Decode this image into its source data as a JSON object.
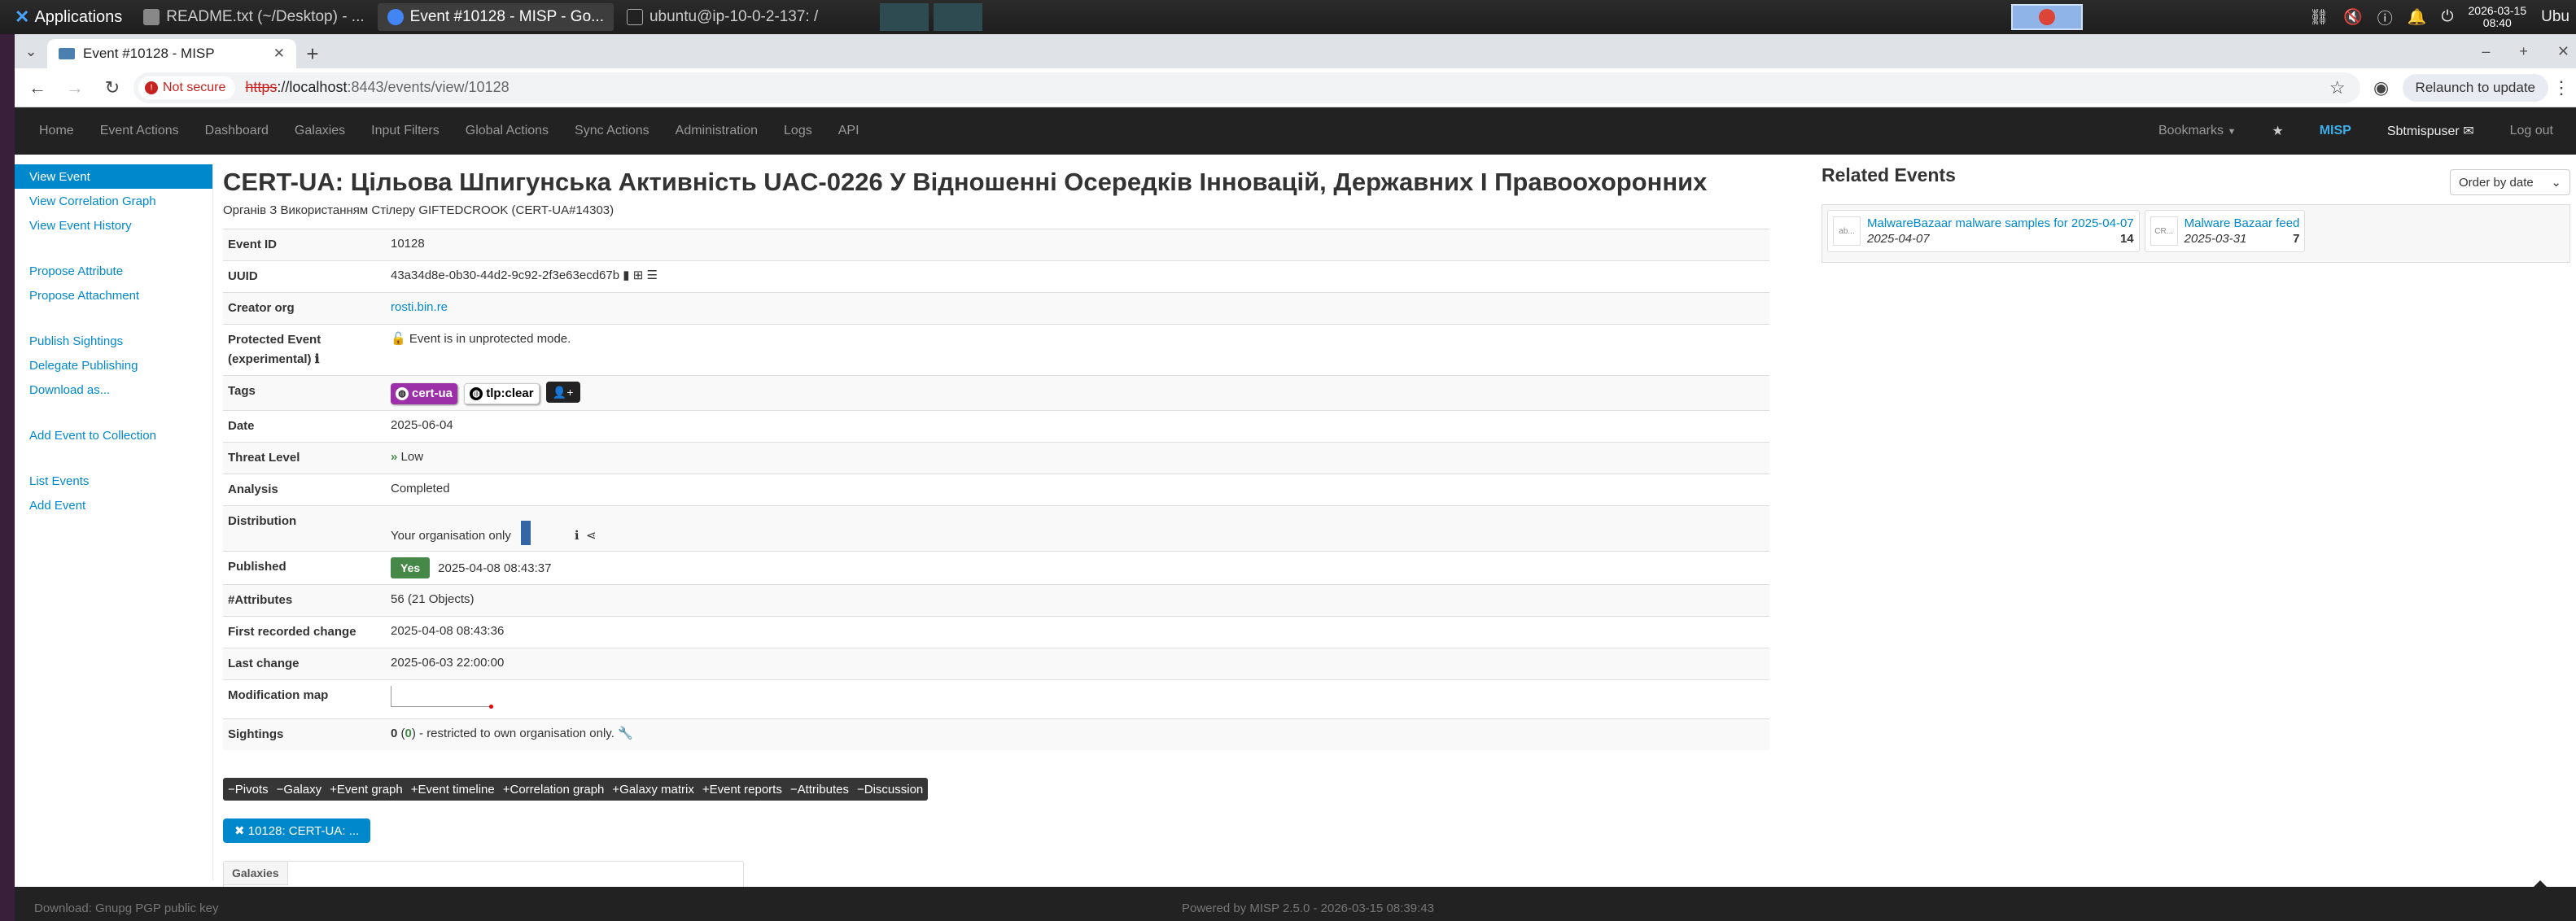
{
  "taskbar": {
    "apps_label": "Applications",
    "tasks": [
      {
        "label": "README.txt (~/Desktop) - ..."
      },
      {
        "label": "Event #10128 - MISP - Go..."
      },
      {
        "label": "ubuntu@ip-10-0-2-137: /"
      }
    ],
    "clock_date": "2026-03-15",
    "clock_time": "08:40",
    "tray_user": "Ubu"
  },
  "browser": {
    "tab_title": "Event #10128 - MISP",
    "not_secure": "Not secure",
    "url_scheme": "https",
    "url_host": "://localhost",
    "url_path": ":8443/events/view/10128",
    "relaunch": "Relaunch to update"
  },
  "mispnav": {
    "items": [
      "Home",
      "Event Actions",
      "Dashboard",
      "Galaxies",
      "Input Filters",
      "Global Actions",
      "Sync Actions",
      "Administration",
      "Logs",
      "API"
    ],
    "bookmarks": "Bookmarks",
    "misp": "MISP",
    "user": "Sbtmispuser",
    "logout": "Log out"
  },
  "sidebar": {
    "view_event": "View Event",
    "view_correlation_graph": "View Correlation Graph",
    "view_event_history": "View Event History",
    "propose_attribute": "Propose Attribute",
    "propose_attachment": "Propose Attachment",
    "publish_sightings": "Publish Sightings",
    "delegate_publishing": "Delegate Publishing",
    "download_as": "Download as...",
    "add_event_to_collection": "Add Event to Collection",
    "list_events": "List Events",
    "add_event": "Add Event"
  },
  "event": {
    "title": "CERT-UA: Цільова Шпигунська Активність UAC-0226 У Відношенні Осередків Інновацій, Державних І Правоохоронних",
    "subtitle": "Органів З Використанням Стілеру GIFTEDCROOK (CERT-UA#14303)",
    "labels": {
      "event_id": "Event ID",
      "uuid": "UUID",
      "creator_org": "Creator org",
      "protected_event": "Protected Event",
      "protected_event_sub": "(experimental)",
      "tags": "Tags",
      "date": "Date",
      "threat_level": "Threat Level",
      "analysis": "Analysis",
      "distribution": "Distribution",
      "published": "Published",
      "attributes": "#Attributes",
      "first_recorded_change": "First recorded change",
      "last_change": "Last change",
      "modification_map": "Modification map",
      "sightings": "Sightings"
    },
    "event_id": "10128",
    "uuid": "43a34d8e-0b30-44d2-9c92-2f3e63ecd67b",
    "creator_org": "rosti.bin.re",
    "protected_text": "Event is in unprotected mode.",
    "tags": [
      "cert-ua",
      "tlp:clear"
    ],
    "date": "2025-06-04",
    "threat_level": "Low",
    "analysis": "Completed",
    "distribution": "Your organisation only",
    "published_badge": "Yes",
    "published_date": "2025-04-08 08:43:37",
    "attributes": "56 (21 Objects)",
    "first_recorded_change": "2025-04-08 08:43:36",
    "last_change": "2025-06-03 22:00:00",
    "sightings_count": "0",
    "sightings_own": "0",
    "sightings_text": " - restricted to own organisation only."
  },
  "toggles": [
    "Pivots",
    "Galaxy",
    "Event graph",
    "Event timeline",
    "Correlation graph",
    "Galaxy matrix",
    "Event reports",
    "Attributes",
    "Discussion"
  ],
  "toggle_signs": [
    "−",
    "−",
    "+",
    "+",
    "+",
    "+",
    "+",
    "−",
    "−"
  ],
  "filter_pill": "10128: CERT-UA: ...",
  "galaxies_header": "Galaxies",
  "related": {
    "title": "Related Events",
    "order_by": "Order by date",
    "events": [
      {
        "org": "ab...",
        "title": "MalwareBazaar malware samples for 2025-04-07",
        "date": "2025-04-07",
        "count": "14"
      },
      {
        "org": "CR...",
        "title": "Malware Bazaar feed",
        "date": "2025-03-31",
        "count": "7"
      }
    ]
  },
  "footer": {
    "left": "Download: Gnupg PGP public key",
    "center": "Powered by MISP 2.5.0 - 2026-03-15 08:39:43"
  }
}
